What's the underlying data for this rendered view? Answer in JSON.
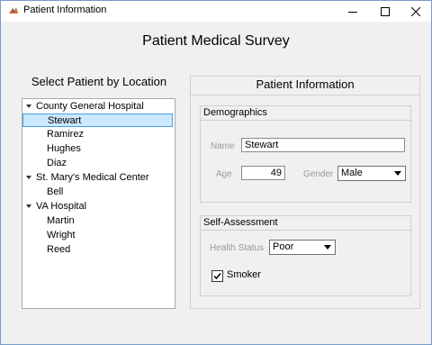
{
  "window": {
    "title": "Patient Information",
    "controls": [
      "minimize-icon",
      "maximize-icon",
      "close-icon"
    ]
  },
  "main_title": "Patient Medical Survey",
  "left": {
    "title": "Select Patient by Location",
    "tree": {
      "groups": [
        {
          "label": "County General Hospital",
          "children": [
            "Stewart",
            "Ramirez",
            "Hughes",
            "Diaz"
          ]
        },
        {
          "label": "St. Mary's Medical Center",
          "children": [
            "Bell"
          ]
        },
        {
          "label": "VA Hospital",
          "children": [
            "Martin",
            "Wright",
            "Reed"
          ]
        }
      ],
      "selected": "Stewart"
    }
  },
  "right": {
    "title": "Patient Information",
    "demographics": {
      "title": "Demographics",
      "name_label": "Name",
      "name_value": "Stewart",
      "age_label": "Age",
      "age_value": "49",
      "gender_label": "Gender",
      "gender_value": "Male"
    },
    "self_assessment": {
      "title": "Self-Assessment",
      "health_label": "Health Status",
      "health_value": "Poor",
      "smoker_label": "Smoker",
      "smoker_checked": true
    }
  },
  "colors": {
    "selection_bg": "#cce8ff",
    "selection_border": "#4aa0e0",
    "window_bg": "#f0f0f0"
  }
}
